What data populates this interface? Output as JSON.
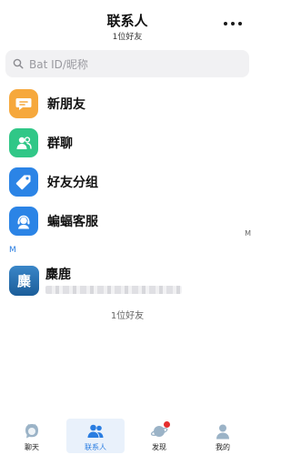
{
  "header": {
    "title": "联系人",
    "subtitle": "1位好友",
    "more_icon": "more-dots-icon"
  },
  "search": {
    "placeholder": "Bat ID/昵称",
    "icon": "search-icon"
  },
  "menu": [
    {
      "label": "新朋友",
      "icon": "new-friend-icon",
      "color": "#f6a83c"
    },
    {
      "label": "群聊",
      "icon": "group-chat-icon",
      "color": "#30c787"
    },
    {
      "label": "好友分组",
      "icon": "tag-icon",
      "color": "#2b84e6"
    },
    {
      "label": "蝙蝠客服",
      "icon": "customer-service-icon",
      "color": "#2b84e6"
    }
  ],
  "index_letter": "M",
  "section_header": "M",
  "contacts": [
    {
      "name": "麋鹿",
      "avatar_text": "麋",
      "avatar_color": "#2a73b5"
    }
  ],
  "footer_count": "1位好友",
  "bottom_nav": [
    {
      "label": "聊天",
      "icon": "chat-icon",
      "active": false
    },
    {
      "label": "联系人",
      "icon": "contacts-icon",
      "active": true
    },
    {
      "label": "发现",
      "icon": "discover-planet-icon",
      "active": false,
      "badge_dot": true
    },
    {
      "label": "我的",
      "icon": "profile-icon",
      "active": false
    }
  ],
  "colors": {
    "accent": "#2a7de1",
    "badge": "#e62e2e"
  }
}
